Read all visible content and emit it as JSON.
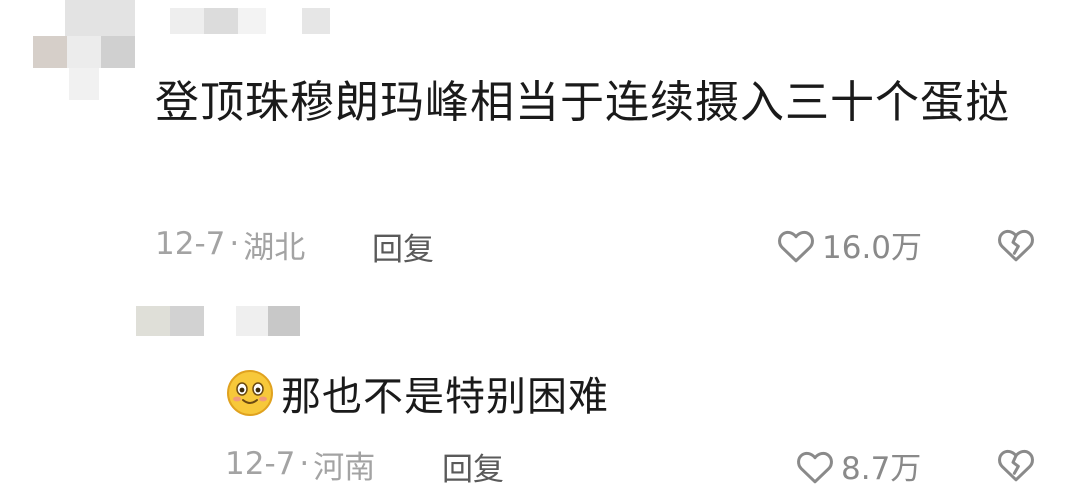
{
  "comment": {
    "text": "登顶珠穆朗玛峰相当于连续摄入三十个蛋挞",
    "date": "12-7",
    "location": "湖北",
    "reply_label": "回复",
    "likes": "16.0万"
  },
  "reply": {
    "emoji": "smiling-face-emoji",
    "text": "那也不是特别困难",
    "date": "12-7",
    "location": "河南",
    "reply_label": "回复",
    "likes": "8.7万"
  },
  "icons": {
    "like": "heart-outline-icon",
    "dislike": "broken-heart-icon"
  },
  "colors": {
    "text": "#1a1a1a",
    "meta": "#a3a3a3",
    "icon": "#8a8a8a"
  }
}
